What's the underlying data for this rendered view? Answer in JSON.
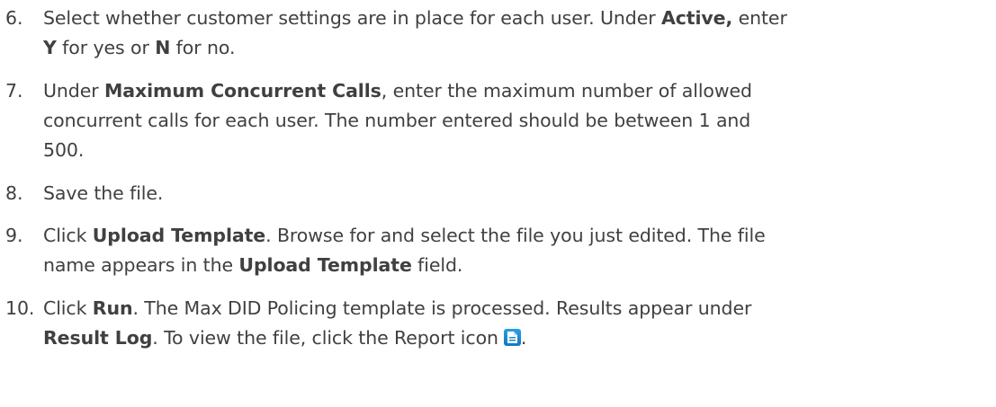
{
  "steps": [
    {
      "number": "6.",
      "lines": [
        [
          {
            "t": "Select whether customer settings are in place for each user. Under ",
            "b": false
          },
          {
            "t": "Active,",
            "b": true
          },
          {
            "t": " enter",
            "b": false
          }
        ],
        [
          {
            "t": "Y",
            "b": true
          },
          {
            "t": " for yes or ",
            "b": false
          },
          {
            "t": "N",
            "b": true
          },
          {
            "t": " for no.",
            "b": false
          }
        ]
      ]
    },
    {
      "number": "7.",
      "lines": [
        [
          {
            "t": "Under ",
            "b": false
          },
          {
            "t": "Maximum Concurrent Calls",
            "b": true
          },
          {
            "t": ", enter the maximum number of allowed",
            "b": false
          }
        ],
        [
          {
            "t": "concurrent calls for each user. The number entered should be between 1 and",
            "b": false
          }
        ],
        [
          {
            "t": "500.",
            "b": false
          }
        ]
      ]
    },
    {
      "number": "8.",
      "lines": [
        [
          {
            "t": "Save the file.",
            "b": false
          }
        ]
      ]
    },
    {
      "number": "9.",
      "lines": [
        [
          {
            "t": "Click ",
            "b": false
          },
          {
            "t": "Upload Template",
            "b": true
          },
          {
            "t": ". Browse for and select the file you just edited. The file",
            "b": false
          }
        ],
        [
          {
            "t": "name appears in the ",
            "b": false
          },
          {
            "t": "Upload Template",
            "b": true
          },
          {
            "t": " field.",
            "b": false
          }
        ]
      ]
    },
    {
      "number": "10.",
      "lines": [
        [
          {
            "t": "Click ",
            "b": false
          },
          {
            "t": "Run",
            "b": true
          },
          {
            "t": ". The Max DID Policing template is processed. Results appear under",
            "b": false
          }
        ],
        [
          {
            "t": "Result Log",
            "b": true
          },
          {
            "t": ". To view the file, click the Report icon",
            "b": false
          },
          {
            "icon": "report-icon"
          },
          {
            "t": ".",
            "b": false
          }
        ]
      ]
    }
  ],
  "colors": {
    "text": "#404040",
    "icon": "#1a86d0"
  }
}
